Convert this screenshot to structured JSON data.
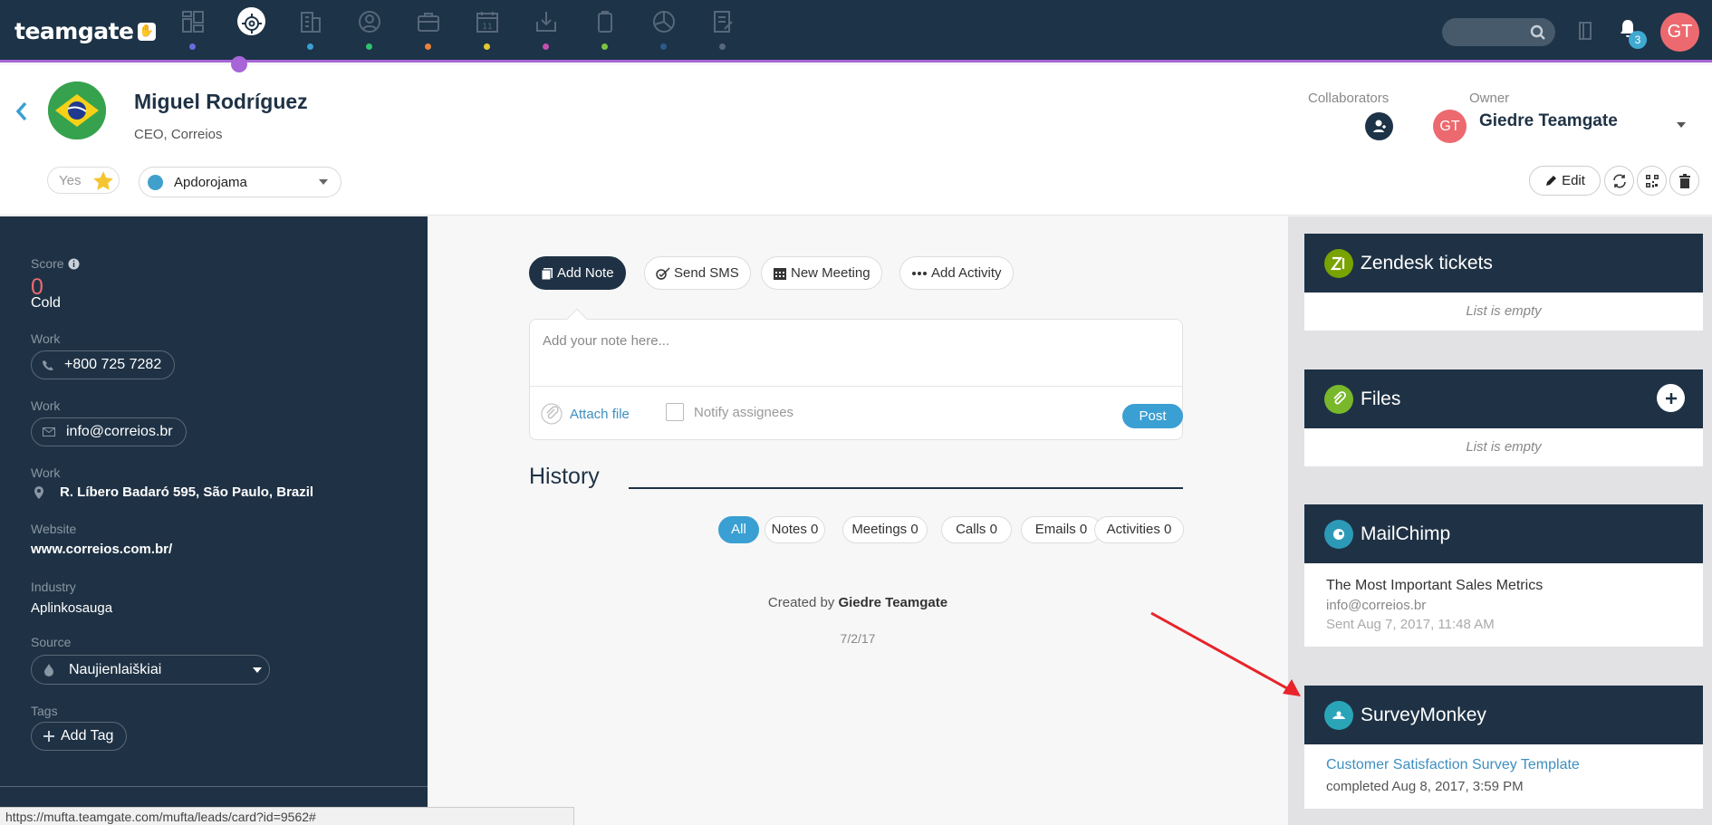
{
  "app": {
    "brand": "teamgate"
  },
  "topnav": {
    "notification_count": "3",
    "user_initials": "GT",
    "icons": [
      "dashboard-icon",
      "leads-icon",
      "companies-icon",
      "contacts-icon",
      "deals-icon",
      "calendar-icon",
      "import-icon",
      "documents-icon",
      "reports-icon",
      "tasks-icon"
    ]
  },
  "contact": {
    "name": "Miguel Rodríguez",
    "title": "CEO, Correios",
    "favorite_label": "Yes",
    "stage": "Apdorojama"
  },
  "collaborators": {
    "label": "Collaborators"
  },
  "owner": {
    "label": "Owner",
    "initials": "GT",
    "name": "Giedre Teamgate"
  },
  "actions": {
    "edit": "Edit"
  },
  "details": {
    "score_label": "Score",
    "score_value": "0",
    "score_temp": "Cold",
    "phone_label": "Work",
    "phone": "+800 725 7282",
    "email_label": "Work",
    "email": "info@correios.br",
    "address_label": "Work",
    "address": "R. Líbero Badaró 595, São Paulo, Brazil",
    "website_label": "Website",
    "website": "www.correios.com.br/",
    "industry_label": "Industry",
    "industry": "Aplinkosauga",
    "source_label": "Source",
    "source": "Naujienlaiškiai",
    "tags_label": "Tags",
    "add_tag": "Add Tag"
  },
  "composer": {
    "tabs": [
      "Add Note",
      "Send SMS",
      "New Meeting",
      "Add Activity"
    ],
    "placeholder": "Add your note here...",
    "attach": "Attach file",
    "notify": "Notify assignees",
    "post": "Post"
  },
  "history": {
    "title": "History",
    "filters": [
      "All",
      "Notes 0",
      "Meetings 0",
      "Calls 0",
      "Emails 0",
      "Activities 0"
    ],
    "created_prefix": "Created by",
    "created_by": "Giedre Teamgate",
    "created_date": "7/2/17"
  },
  "widgets": {
    "zendesk": {
      "title": "Zendesk tickets",
      "empty": "List is empty"
    },
    "files": {
      "title": "Files",
      "empty": "List is empty"
    },
    "mailchimp": {
      "title": "MailChimp",
      "campaign": "The Most Important Sales Metrics",
      "email": "info@correios.br",
      "sent": "Sent Aug 7, 2017, 11:48 AM"
    },
    "surveymonkey": {
      "title": "SurveyMonkey",
      "survey": "Customer Satisfaction Survey Template",
      "status": "completed Aug 8, 2017, 3:59 PM"
    }
  },
  "statusbar": {
    "url": "https://mufta.teamgate.com/mufta/leads/card?id=9562#"
  },
  "colors": {
    "nav_bg": "#1d3347",
    "accent_purple": "#a865d8",
    "accent_blue": "#3a9fd2",
    "score_red": "#ec6a6f"
  }
}
